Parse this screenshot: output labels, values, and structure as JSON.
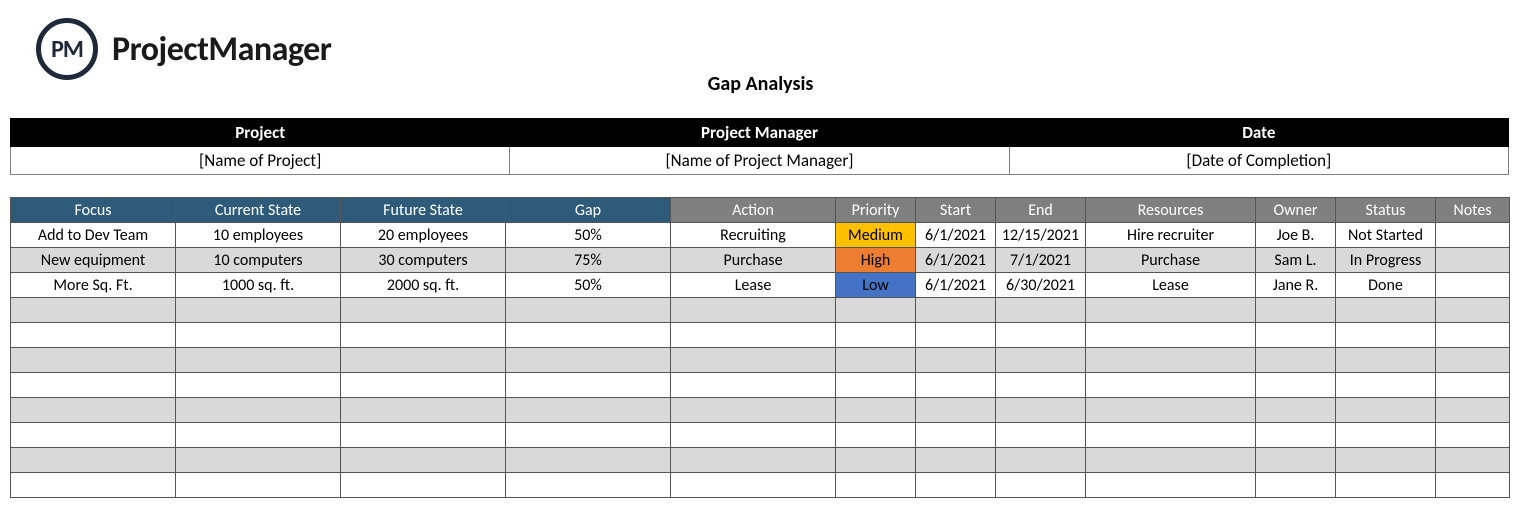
{
  "brand": {
    "logo_abbr": "PM",
    "logo_text": "ProjectManager"
  },
  "title": "Gap Analysis",
  "meta": {
    "headers": [
      "Project",
      "Project Manager",
      "Date"
    ],
    "values": [
      "[Name of Project]",
      "[Name of Project Manager]",
      "[Date of Completion]"
    ]
  },
  "columns": [
    {
      "label": "Focus",
      "style": "hdr-blue",
      "width": "col-focus"
    },
    {
      "label": "Current State",
      "style": "hdr-blue",
      "width": "col-state"
    },
    {
      "label": "Future State",
      "style": "hdr-blue",
      "width": "col-state"
    },
    {
      "label": "Gap",
      "style": "hdr-blue",
      "width": "col-gap"
    },
    {
      "label": "Action",
      "style": "hdr-gray",
      "width": "col-action"
    },
    {
      "label": "Priority",
      "style": "hdr-gray",
      "width": "col-priority"
    },
    {
      "label": "Start",
      "style": "hdr-gray",
      "width": "col-start"
    },
    {
      "label": "End",
      "style": "hdr-gray",
      "width": "col-end"
    },
    {
      "label": "Resources",
      "style": "hdr-gray",
      "width": "col-resources"
    },
    {
      "label": "Owner",
      "style": "hdr-gray",
      "width": "col-owner"
    },
    {
      "label": "Status",
      "style": "hdr-gray",
      "width": "col-status"
    },
    {
      "label": "Notes",
      "style": "hdr-gray",
      "width": "col-notes"
    }
  ],
  "rows": [
    {
      "stripe": "white",
      "focus": "Add to Dev Team",
      "current": "10 employees",
      "future": "20 employees",
      "gap": "50%",
      "action": "Recruiting",
      "priority": "Medium",
      "priority_class": "prio-medium",
      "start": "6/1/2021",
      "end": "12/15/2021",
      "resources": "Hire recruiter",
      "owner": "Joe B.",
      "status": "Not Started",
      "notes": ""
    },
    {
      "stripe": "gray",
      "focus": "New equipment",
      "current": "10 computers",
      "future": "30 computers",
      "gap": "75%",
      "action": "Purchase",
      "priority": "High",
      "priority_class": "prio-high",
      "start": "6/1/2021",
      "end": "7/1/2021",
      "resources": "Purchase",
      "owner": "Sam L.",
      "status": "In Progress",
      "notes": ""
    },
    {
      "stripe": "white",
      "focus": "More Sq. Ft.",
      "current": "1000 sq. ft.",
      "future": "2000 sq. ft.",
      "gap": "50%",
      "action": "Lease",
      "priority": "Low",
      "priority_class": "prio-low",
      "start": "6/1/2021",
      "end": "6/30/2021",
      "resources": "Lease",
      "owner": "Jane R.",
      "status": "Done",
      "notes": ""
    }
  ],
  "empty_row_count": 8
}
